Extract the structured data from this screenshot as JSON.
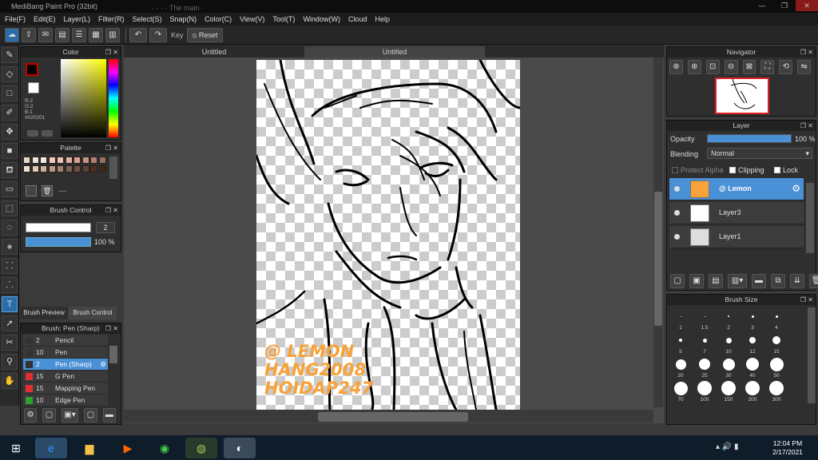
{
  "window": {
    "title": "MediBang Paint Pro (32bit)",
    "bg_tabs": "·  ·  ·  ·  The main ·"
  },
  "menu": [
    "File(F)",
    "Edit(E)",
    "Layer(L)",
    "Filter(R)",
    "Select(S)",
    "Snap(N)",
    "Color(C)",
    "View(V)",
    "Tool(T)",
    "Window(W)",
    "Cloud",
    "Help"
  ],
  "toolbar": {
    "key_label": "Key",
    "reset_label": "Reset"
  },
  "color_panel": {
    "title": "Color",
    "r": "R:2",
    "g": "G:2",
    "b": "B:1",
    "hex": "#020201",
    "fg_color": "#020201",
    "accent": "#cc0000"
  },
  "palette": {
    "title": "Palette",
    "swatches": [
      "#e8d8c0",
      "#f0e4d8",
      "#f8e8e0",
      "#f5c8c0",
      "#f0c0b0",
      "#e8b0a0",
      "#d8a090",
      "#c89080",
      "#b08070",
      "#9a7060",
      "#f0e0d0",
      "#e0c8b0",
      "#d0b098",
      "#c09880",
      "#a08070",
      "#806050",
      "#705040",
      "#604030",
      "#503020",
      "#402818"
    ],
    "page_label": "---"
  },
  "brush_control": {
    "title": "Brush Control",
    "size": "2",
    "opacity": "100 %"
  },
  "brush_tabs": {
    "preview": "Brush Preview",
    "control": "Brush Control"
  },
  "brush_list": {
    "title": "Brush: Pen (Sharp)",
    "items": [
      {
        "num": "2",
        "name": "Pencil",
        "color": "#333333"
      },
      {
        "num": "10",
        "name": "Pen",
        "color": "#333333"
      },
      {
        "num": "2",
        "name": "Pen (Sharp)",
        "color": "#333333",
        "selected": true
      },
      {
        "num": "15",
        "name": "G Pen",
        "color": "#e03030"
      },
      {
        "num": "15",
        "name": "Mapping Pen",
        "color": "#e03030"
      },
      {
        "num": "10",
        "name": "Edge Pen",
        "color": "#30a030"
      }
    ]
  },
  "canvas": {
    "tabs": [
      "Untitled",
      "Untitled"
    ],
    "watermark": [
      "@ LEMON",
      "HANG2008",
      "HOIDAP247"
    ]
  },
  "navigator": {
    "title": "Navigator"
  },
  "layer_panel": {
    "title": "Layer",
    "opacity_label": "Opacity",
    "opacity_value": "100 %",
    "opacity_fraction": 1.0,
    "blending_label": "Blending",
    "blending_value": "Normal",
    "protect_alpha": "Protect Alpha",
    "clipping": "Clipping",
    "lock": "Lock",
    "layers": [
      {
        "name": "@ Lemon",
        "selected": true
      },
      {
        "name": "Layer3",
        "selected": false
      },
      {
        "name": "Layer1",
        "selected": false
      }
    ]
  },
  "brush_size": {
    "title": "Brush Size",
    "sizes": [
      "1",
      "1.5",
      "2",
      "3",
      "4",
      "5",
      "7",
      "10",
      "12",
      "15",
      "20",
      "25",
      "30",
      "40",
      "50",
      "70",
      "100",
      "150",
      "200",
      "300"
    ]
  },
  "taskbar": {
    "time": "12:04 PM",
    "date": "2/17/2021"
  }
}
